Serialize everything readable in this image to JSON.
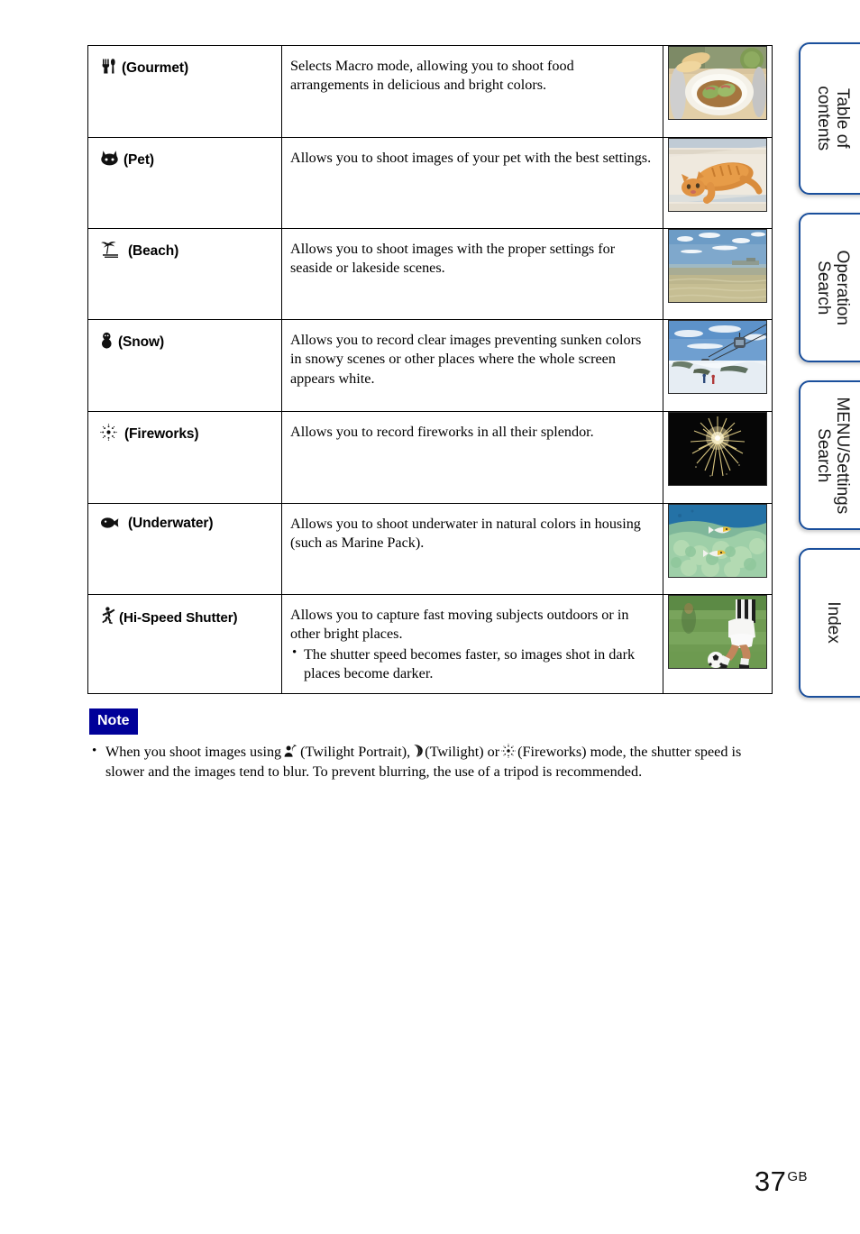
{
  "page": {
    "number": "37",
    "region_code": "GB"
  },
  "colors": {
    "note_badge_bg": "#000099",
    "tab_border": "#1a4f9c",
    "table_border": "#000000"
  },
  "table": {
    "rows": [
      {
        "icon": "fork-knife-icon",
        "mode_label": "(Gourmet)",
        "description": "Selects Macro mode, allowing you to shoot food arrangements in delicious and bright colors.",
        "bullets": [],
        "photo": "food-plate-photo"
      },
      {
        "icon": "cat-face-icon",
        "mode_label": "(Pet)",
        "description": "Allows you to shoot images of your pet with the best settings.",
        "bullets": [],
        "photo": "orange-cat-photo"
      },
      {
        "icon": "palm-tree-icon",
        "mode_label": "(Beach)",
        "description": "Allows you to shoot images with the proper settings for seaside or lakeside scenes.",
        "bullets": [],
        "photo": "beach-seascape-photo"
      },
      {
        "icon": "snowman-icon",
        "mode_label": "(Snow)",
        "description": "Allows you to record clear images preventing sunken colors in snowy scenes or other places where the whole screen appears white.",
        "bullets": [],
        "photo": "snowy-ski-slope-photo"
      },
      {
        "icon": "fireworks-burst-icon",
        "mode_label": "(Fireworks)",
        "description": "Allows you to record fireworks in all their splendor.",
        "bullets": [],
        "photo": "fireworks-night-photo"
      },
      {
        "icon": "fish-icon",
        "mode_label": "(Underwater)",
        "description": "Allows you to shoot underwater in natural colors in housing (such as Marine Pack).",
        "bullets": [],
        "photo": "coral-reef-fish-photo"
      },
      {
        "icon": "running-person-icon",
        "mode_label": "(Hi-Speed Shutter)",
        "description": "Allows you to capture fast moving subjects outdoors or in other bright places.",
        "bullets": [
          "The shutter speed becomes faster, so images shot in dark places become darker."
        ],
        "photo": "soccer-player-photo"
      }
    ]
  },
  "note": {
    "badge_label": "Note",
    "text_part_1": "When you shoot images using",
    "icon_1": "twilight-portrait-icon",
    "text_part_2": "(Twilight Portrait),",
    "icon_2": "twilight-moon-icon",
    "text_part_3": "(Twilight) or",
    "icon_3": "fireworks-burst-icon",
    "text_part_4": "(Fireworks) mode, the shutter speed is slower and the images tend to blur. To prevent blurring, the use of a tripod is recommended."
  },
  "side_tabs": [
    {
      "label": "Table of\ncontents"
    },
    {
      "label": "Operation\nSearch"
    },
    {
      "label": "MENU/Settings\nSearch"
    },
    {
      "label": "Index"
    }
  ]
}
